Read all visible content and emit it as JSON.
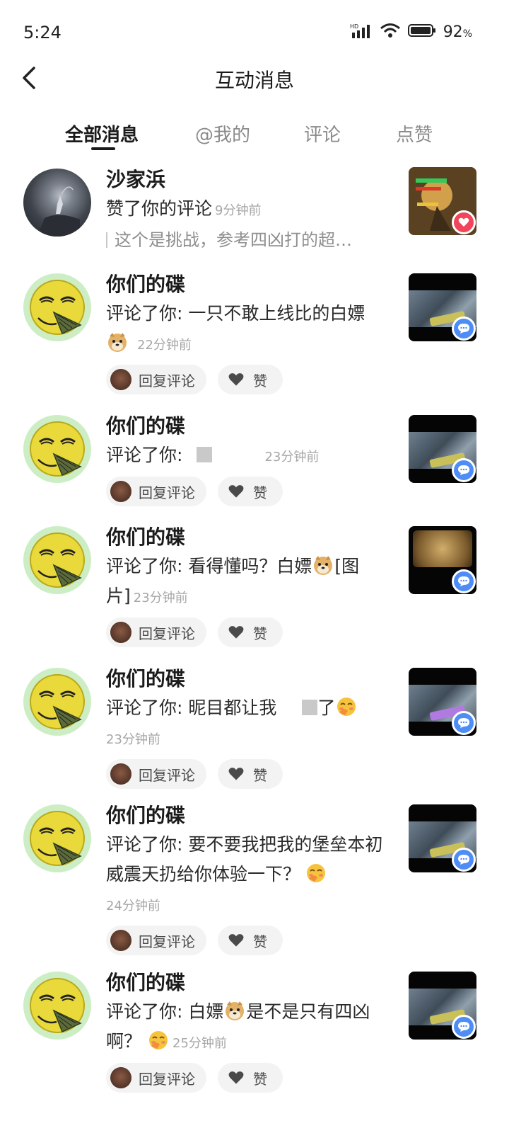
{
  "status": {
    "time": "5:24",
    "battery": "92",
    "battery_unit": "%",
    "network_label": "HD"
  },
  "nav": {
    "title": "互动消息"
  },
  "tabs": [
    {
      "label": "全部消息",
      "active": true
    },
    {
      "label": "@我的",
      "active": false
    },
    {
      "label": "评论",
      "active": false
    },
    {
      "label": "点赞",
      "active": false
    }
  ],
  "items": [
    {
      "username": "沙家浜",
      "action": "赞了你的评论",
      "time": "9分钟前",
      "quote": "这个是挑战，参考四凶打的超…",
      "badge": "heart"
    },
    {
      "username": "你们的碟",
      "action": "评论了你: 一只不敢上线比的白嫖",
      "time": "22分钟前",
      "reply_label": "回复评论",
      "like_label": "赞",
      "badge": "comment"
    },
    {
      "username": "你们的碟",
      "action": "评论了你:",
      "time": "23分钟前",
      "reply_label": "回复评论",
      "like_label": "赞",
      "badge": "comment"
    },
    {
      "username": "你们的碟",
      "action": "评论了你: 看得懂吗？白嫖",
      "action_tail": "[图片]",
      "time": "23分钟前",
      "reply_label": "回复评论",
      "like_label": "赞",
      "badge": "comment"
    },
    {
      "username": "你们的碟",
      "action": "评论了你: 昵目都让我",
      "action_tail": "了",
      "time": "23分钟前",
      "reply_label": "回复评论",
      "like_label": "赞",
      "badge": "comment"
    },
    {
      "username": "你们的碟",
      "action": "评论了你: 要不要我把我的堡垒本初威震天扔给你体验一下？",
      "time": "24分钟前",
      "reply_label": "回复评论",
      "like_label": "赞",
      "badge": "comment"
    },
    {
      "username": "你们的碟",
      "action": "评论了你: 白嫖",
      "action_tail": "是不是只有四凶啊？",
      "time": "25分钟前",
      "reply_label": "回复评论",
      "like_label": "赞",
      "badge": "comment"
    }
  ],
  "colors": {
    "heart": "#f0455a",
    "comment": "#4e8df5",
    "smiley_bg": "#cdeec4"
  }
}
